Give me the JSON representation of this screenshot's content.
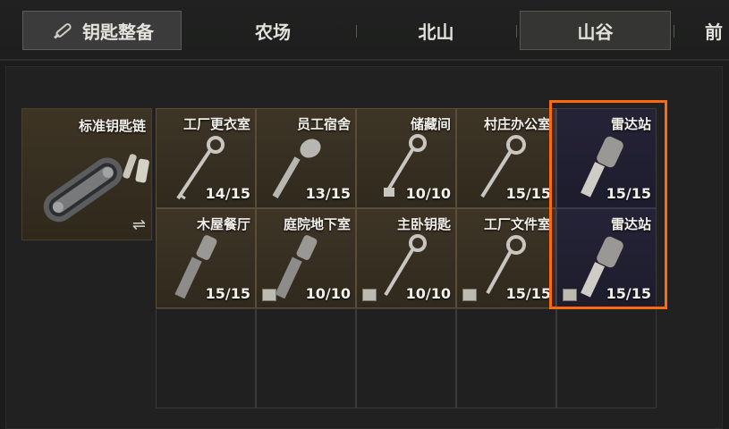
{
  "tabs": {
    "keyring_label": "钥匙整备",
    "farm": "农场",
    "north_mountain": "北山",
    "valley": "山谷",
    "partial": "前"
  },
  "keyring": {
    "title": "标准钥匙链",
    "swap_symbol": "⇌"
  },
  "keys": [
    {
      "name": "工厂更衣室",
      "count": "14/15",
      "has_box": false
    },
    {
      "name": "员工宿舍",
      "count": "13/15",
      "has_box": false
    },
    {
      "name": "储藏间",
      "count": "10/10",
      "has_box": false
    },
    {
      "name": "村庄办公室",
      "count": "15/15",
      "has_box": false
    },
    {
      "name": "雷达站",
      "count": "15/15",
      "has_box": false
    },
    {
      "name": "木屋餐厅",
      "count": "15/15",
      "has_box": false
    },
    {
      "name": "庭院地下室",
      "count": "10/10",
      "has_box": true
    },
    {
      "name": "主卧钥匙",
      "count": "10/10",
      "has_box": true
    },
    {
      "name": "工厂文件室",
      "count": "15/15",
      "has_box": true
    },
    {
      "name": "雷达站",
      "count": "15/15",
      "has_box": true
    }
  ],
  "colors": {
    "highlight": "#ff6a10",
    "filled_slot": "#3e3526",
    "radar_slot": "#252336"
  }
}
